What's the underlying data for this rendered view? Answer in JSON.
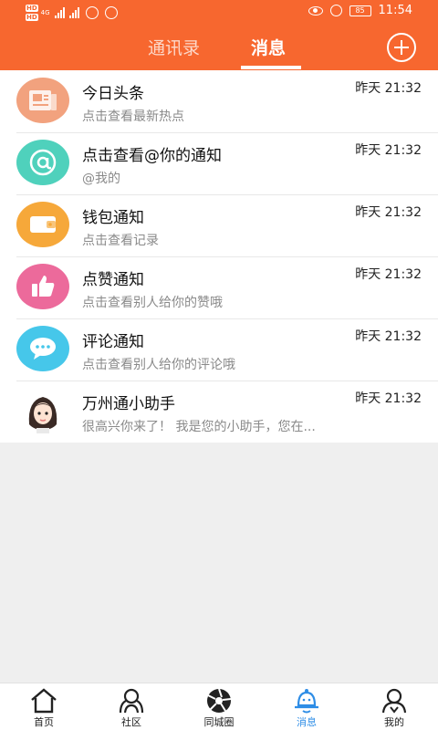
{
  "status_bar": {
    "hd_labels": [
      "HD",
      "HD"
    ],
    "network_badge": "4G",
    "battery_level": "85",
    "time": "11:54"
  },
  "header": {
    "tabs": [
      {
        "label": "通讯录",
        "active": false
      },
      {
        "label": "消息",
        "active": true
      }
    ],
    "add_icon": "plus-circle-icon"
  },
  "messages": [
    {
      "title": "今日头条",
      "subtitle": "点击查看最新热点",
      "time": "昨天 21:32",
      "icon": "newspaper-icon",
      "color": "#f2a27e"
    },
    {
      "title": "点击查看@你的通知",
      "subtitle": "@我的",
      "time": "昨天 21:32",
      "icon": "at-sign-icon",
      "color": "#4fd1bc"
    },
    {
      "title": "钱包通知",
      "subtitle": "点击查看记录",
      "time": "昨天 21:32",
      "icon": "wallet-icon",
      "color": "#f6a83a"
    },
    {
      "title": "点赞通知",
      "subtitle": "点击查看别人给你的赞哦",
      "time": "昨天 21:32",
      "icon": "thumbs-up-icon",
      "color": "#ec6a9b"
    },
    {
      "title": "评论通知",
      "subtitle": "点击查看别人给你的评论哦",
      "time": "昨天 21:32",
      "icon": "comment-bubble-icon",
      "color": "#46c7ea"
    },
    {
      "title": "万州通小助手",
      "subtitle": "很高兴你来了！ 我是您的小助手，您在...",
      "time": "昨天 21:32",
      "icon": "assistant-avatar",
      "color": "#ffffff"
    }
  ],
  "tabbar": {
    "items": [
      {
        "label": "首页",
        "icon": "home-icon",
        "active": false
      },
      {
        "label": "社区",
        "icon": "community-icon",
        "active": false
      },
      {
        "label": "同城圈",
        "icon": "aperture-icon",
        "active": false
      },
      {
        "label": "消息",
        "icon": "bell-chat-icon",
        "active": true
      },
      {
        "label": "我的",
        "icon": "user-icon",
        "active": false
      }
    ],
    "active_color": "#2e8de6"
  },
  "colors": {
    "accent": "#f7672f",
    "background": "#efefef"
  }
}
